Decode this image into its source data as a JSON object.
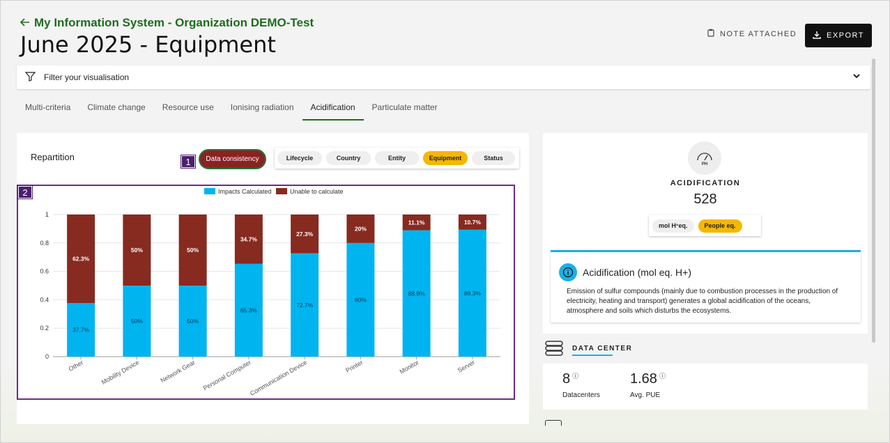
{
  "header": {
    "back_label": "My Information System - Organization DEMO-Test",
    "title": "June 2025 - Equipment",
    "note_label": "NOTE ATTACHED",
    "export_label": "EXPORT"
  },
  "filter": {
    "label": "Filter your visualisation"
  },
  "tabs": [
    {
      "label": "Multi-criteria"
    },
    {
      "label": "Climate change"
    },
    {
      "label": "Resource use"
    },
    {
      "label": "Ionising radiation"
    },
    {
      "label": "Acidification",
      "active": true
    },
    {
      "label": "Particulate matter"
    }
  ],
  "repartition": {
    "title": "Repartition",
    "badge1": "1",
    "badge2": "2",
    "data_consistency_label": "Data consistency",
    "segments": [
      {
        "label": "Lifecycle"
      },
      {
        "label": "Country"
      },
      {
        "label": "Entity"
      },
      {
        "label": "Equipment",
        "active": true
      },
      {
        "label": "Status"
      }
    ]
  },
  "chart_data": {
    "type": "bar",
    "stacked": true,
    "categories": [
      "Other",
      "Mobility Device",
      "Network Gear",
      "Personal Computer",
      "Communication Device",
      "Printer",
      "Monitor",
      "Server"
    ],
    "series": [
      {
        "name": "Impacts Calculated",
        "color": "#00b4f0",
        "values": [
          0.377,
          0.5,
          0.5,
          0.653,
          0.727,
          0.8,
          0.889,
          0.893
        ],
        "labels": [
          "37.7%",
          "50%",
          "50%",
          "65.3%",
          "72.7%",
          "80%",
          "88.9%",
          "89.3%"
        ]
      },
      {
        "name": "Unable to calculate",
        "color": "#872a20",
        "values": [
          0.623,
          0.5,
          0.5,
          0.347,
          0.273,
          0.2,
          0.111,
          0.107
        ],
        "labels": [
          "62.3%",
          "50%",
          "50%",
          "34.7%",
          "27.3%",
          "20%",
          "11.1%",
          "10.7%"
        ]
      }
    ],
    "yticks": [
      "0",
      "0.2",
      "0.4",
      "0.6",
      "0.8",
      "1"
    ],
    "ylim": [
      0,
      1
    ],
    "legend": "top-center"
  },
  "acidification": {
    "icon_text": "PH",
    "label": "ACIDIFICATION",
    "value": "528",
    "units": [
      {
        "label_main": "mol H",
        "label_sup": "+",
        "label_end": " eq."
      },
      {
        "label_main": "People eq.",
        "active": true
      }
    ],
    "info_title": "Acidification (mol eq. H+)",
    "info_text": "Emission of sulfur compounds (mainly due to combustion processes in the production of electricity, heating and transport) generates a global acidification of the oceans, atmosphere and soils which disturbs the ecosystems."
  },
  "data_center": {
    "title": "DATA CENTER",
    "metrics": [
      {
        "value": "8",
        "label": "Datacenters"
      },
      {
        "value": "1.68",
        "label": "Avg. PUE"
      }
    ]
  },
  "colors": {
    "accent_green": "#1f6b1f",
    "dc_red": "#8b2222",
    "active_yellow": "#f4b800",
    "info_blue": "#1ab0e6"
  }
}
